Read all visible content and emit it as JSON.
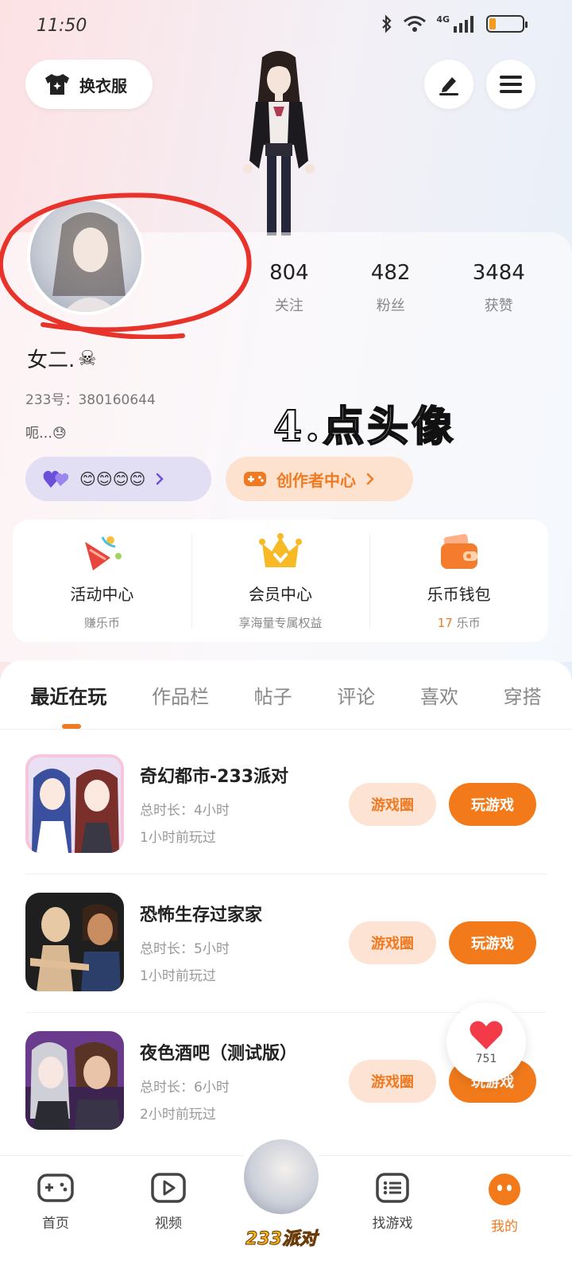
{
  "status_bar": {
    "time": "11:50",
    "network": "4G"
  },
  "header": {
    "change_clothes_label": "换衣服"
  },
  "profile": {
    "stats": [
      {
        "value": "804",
        "label": "关注"
      },
      {
        "value": "482",
        "label": "粉丝"
      },
      {
        "value": "3484",
        "label": "获赞"
      }
    ],
    "nickname": "女二.",
    "nickname_emoji": "☠",
    "user_id": "233号：380160644",
    "bio": "呃…",
    "bio_emoji": "😓",
    "annotation": "4.点头像",
    "friends_emojis": "😊😊😊😊",
    "creator_label": "创作者中心"
  },
  "quick_links": [
    {
      "title": "活动中心",
      "subtitle": "赚乐币"
    },
    {
      "title": "会员中心",
      "subtitle": "享海量专属权益"
    },
    {
      "title": "乐币钱包",
      "subtitle_num": "17",
      "subtitle": "乐币"
    }
  ],
  "tabs": [
    "最近在玩",
    "作品栏",
    "帖子",
    "评论",
    "喜欢",
    "穿搭"
  ],
  "games": [
    {
      "title": "奇幻都市-233派对",
      "duration": "总时长：4小时",
      "last_played": "1小时前玩过",
      "circle_label": "游戏圈",
      "play_label": "玩游戏"
    },
    {
      "title": "恐怖生存过家家",
      "duration": "总时长：5小时",
      "last_played": "1小时前玩过",
      "circle_label": "游戏圈",
      "play_label": "玩游戏"
    },
    {
      "title": "夜色酒吧（测试版）",
      "duration": "总时长：6小时",
      "last_played": "2小时前玩过",
      "circle_label": "游戏圈",
      "play_label": "玩游戏"
    }
  ],
  "like_float": {
    "count": "751"
  },
  "bottom_nav": {
    "home": "首页",
    "video": "视频",
    "center": "233派对",
    "find_games": "找游戏",
    "mine": "我的"
  },
  "colors": {
    "accent": "#f27a1a",
    "accent_light": "#fde3d4",
    "friends_pill": "#e2def4"
  }
}
